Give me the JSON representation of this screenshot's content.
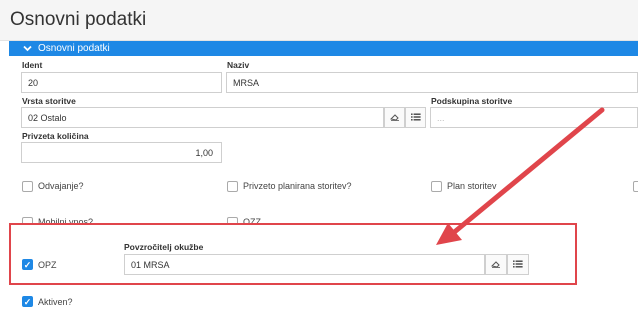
{
  "page": {
    "title": "Osnovni podatki"
  },
  "section": {
    "title": "Osnovni podatki"
  },
  "fields": {
    "ident": {
      "label": "Ident",
      "value": "20"
    },
    "naziv": {
      "label": "Naziv",
      "value": "MRSA"
    },
    "vrsta_storitve": {
      "label": "Vrsta storitve",
      "value": "02 Ostalo"
    },
    "podskupina_storitve": {
      "label": "Podskupina storitve",
      "placeholder": "..."
    },
    "privzeta_kolicina": {
      "label": "Privzeta količina",
      "value": "1,00"
    },
    "povzrocitelj": {
      "label": "Povzročitelj okužbe",
      "value": "01 MRSA"
    }
  },
  "checkboxes": {
    "odvajanje": {
      "label": "Odvajanje?",
      "checked": false
    },
    "privzeto_planirana": {
      "label": "Privzeto planirana storitev?",
      "checked": false
    },
    "plan_storitev": {
      "label": "Plan storitev",
      "checked": false
    },
    "mobilni_vnos": {
      "label": "Mobilni vnos?",
      "checked": false
    },
    "ozz": {
      "label": "OZZ",
      "checked": false
    },
    "opz": {
      "label": "OPZ",
      "checked": true
    },
    "aktiven": {
      "label": "Aktiven?",
      "checked": true
    }
  },
  "icons": {
    "section_toggle": "chevron-down-icon",
    "clear": "eraser-icon",
    "list": "list-icon",
    "checkmark": "check-icon"
  },
  "colors": {
    "accent": "#1e88e5",
    "highlight": "#e0454b",
    "arrow": "#e0454b"
  },
  "glyphs": {
    "check": "✓"
  }
}
